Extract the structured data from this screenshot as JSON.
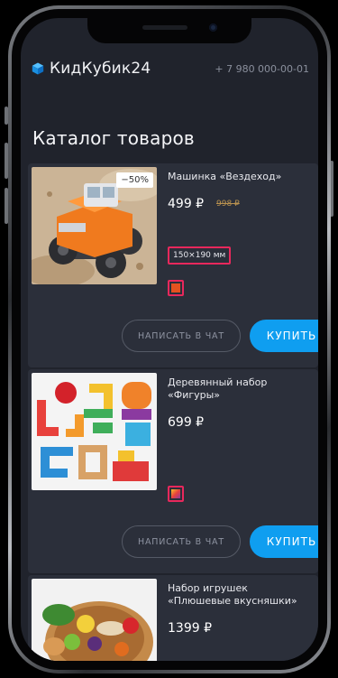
{
  "header": {
    "brand": "КидКубик24",
    "phone": "+ 7 980 000-00-01",
    "logo_icon": "cube-icon",
    "accent": "#1a9bef"
  },
  "page": {
    "title": "Каталог товаров"
  },
  "products": [
    {
      "name": "Машинка «Вездеход»",
      "price": "499 ₽",
      "old_price": "998 ₽",
      "discount": "−50%",
      "size": "150×190 мм",
      "color_swatch": "#e4521f",
      "chat_label": "НАПИСАТЬ В ЧАТ",
      "buy_label": "КУПИТЬ"
    },
    {
      "name": "Деревянный набор «Фигуры»",
      "price": "699 ₽",
      "color_swatch": "multicolor",
      "chat_label": "НАПИСАТЬ В ЧАТ",
      "buy_label": "КУПИТЬ"
    },
    {
      "name": "Набор игрушек «Плюшевые вкусняшки»",
      "price": "1399 ₽"
    }
  ],
  "colors": {
    "buy_button": "#0f9ef0",
    "highlight_border": "#e8285c",
    "card_bg": "#2b2f3a",
    "screen_bg": "#20232c"
  }
}
